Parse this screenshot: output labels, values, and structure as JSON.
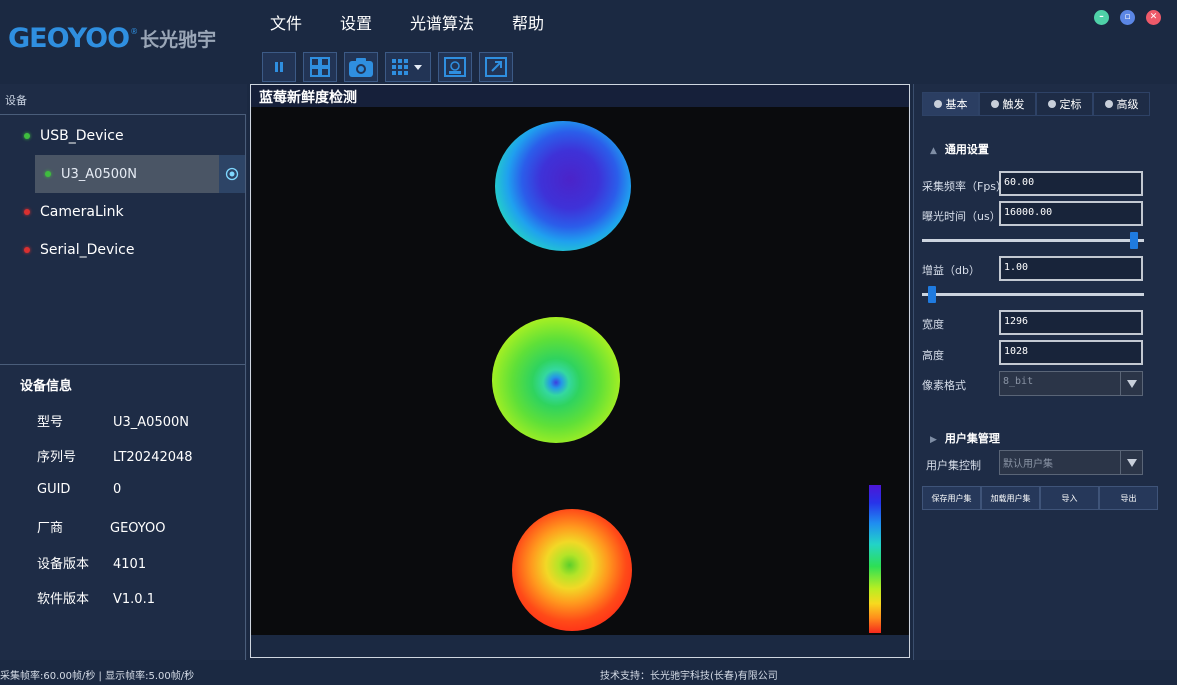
{
  "header": {
    "logo_brand": "GEOYOO",
    "logo_reg": "®",
    "logo_cn": "长光驰宇",
    "menu": [
      "文件",
      "设置",
      "光谱算法",
      "帮助"
    ],
    "window_controls": [
      "minimize-icon",
      "maximize-icon",
      "close-icon"
    ]
  },
  "toolbar": {
    "buttons": [
      "pause-icon",
      "grid-layout-icon",
      "camera-icon",
      "grid-dropdown-icon",
      "ref-icon",
      "expand-icon"
    ]
  },
  "devices": {
    "title": "设备",
    "items": [
      {
        "label": "USB_Device",
        "status": "green"
      },
      {
        "label": "U3_A0500N",
        "status": "green",
        "selected": true
      },
      {
        "label": "CameraLink",
        "status": "red"
      },
      {
        "label": "Serial_Device",
        "status": "red"
      }
    ]
  },
  "device_info": {
    "title": "设备信息",
    "rows": [
      {
        "k": "型号",
        "v": "U3_A0500N"
      },
      {
        "k": "序列号",
        "v": "LT20242048"
      },
      {
        "k": "GUID",
        "v": "0"
      },
      {
        "k": "厂商",
        "v": "GEOYOO"
      },
      {
        "k": "设备版本",
        "v": "4101"
      },
      {
        "k": "软件版本",
        "v": "V1.0.1"
      }
    ]
  },
  "viewer": {
    "title": "蓝莓新鲜度检测"
  },
  "settings": {
    "tabs": [
      "基本",
      "触发",
      "定标",
      "高级"
    ],
    "general_title": "通用设置",
    "fps_label": "采集频率（Fps）",
    "fps_value": "60.00",
    "exposure_label": "曝光时间（us）",
    "exposure_value": "16000.00",
    "exposure_slider": 0.97,
    "gain_label": "增益（db）",
    "gain_value": "1.00",
    "gain_slider": 0.03,
    "width_label": "宽度",
    "width_value": "1296",
    "height_label": "高度",
    "height_value": "1028",
    "pixel_label": "像素格式",
    "pixel_value": "8_bit",
    "userset_title": "用户集管理",
    "userset_label": "用户集控制",
    "userset_value": "默认用户集",
    "userset_buttons": [
      "保存用户集",
      "加载用户集",
      "导入",
      "导出"
    ]
  },
  "status": {
    "left": "采集帧率:60.00帧/秒 | 显示帧率:5.00帧/秒",
    "center": "技术支持：长光驰宇科技(长春)有限公司"
  },
  "colors": {
    "background": "#1b2942",
    "panel": "#1e2c46",
    "accent": "#1f7be0",
    "status_green": "#3fbd3f",
    "status_red": "#d93030"
  }
}
